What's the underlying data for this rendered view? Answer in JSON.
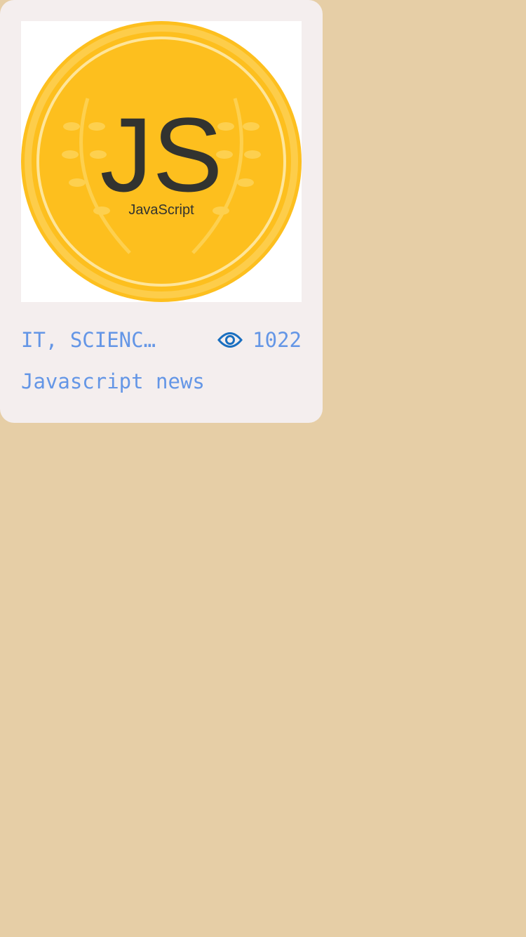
{
  "card": {
    "image": {
      "logo_text": "JS",
      "logo_subtext": "JavaScript",
      "colors": {
        "coin": "#fdbf1e",
        "ink": "#323330"
      }
    },
    "category": "IT, SCIENC…",
    "views_icon": "eye-icon",
    "views": "1022",
    "title": "Javascript news",
    "text_color": "#6496e6",
    "icon_color": "#1a6fc0"
  }
}
